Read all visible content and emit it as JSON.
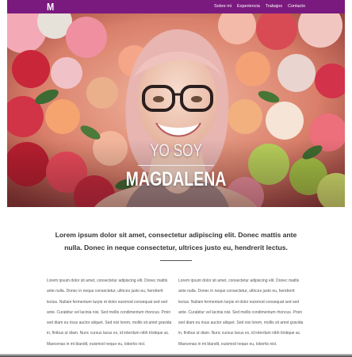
{
  "nav": {
    "logo": "M",
    "links": [
      "Sobre mi",
      "Experiencia",
      "Trabajos",
      "Contacto"
    ]
  },
  "hero": {
    "line1": "YO SOY",
    "line2": "MAGDALENA"
  },
  "intro": {
    "text": "Lorem ipsum dolor sit amet, consectetur adipiscing elit. Donec mattis ante nulla. Donec in neque consectetur, ultrices justo eu, hendrerit lectus."
  },
  "columns": [
    "Lorem ipsum dolor sit amet, consectetur adipiscing elit. Donec mattis ante nulla. Donec in neque consectetur, ultrices justo eu, hendrerit lectus. Nullam fermentum turpis et dolor euismod consequat sed sed ante. Curabitur vel lacinia nisi. Sed mollis condimentum rhoncus. Proin sed diam eu risus auctor aliquet. Sed nisi lorem, mollis sit amet gravida in, finibus ut diam. Nunc cursus lacus ex, id interdum nibh tristique ac. Maecenas in mi blandit, euismod neque eu, lobortis nisl.",
    "Lorem ipsum dolor sit amet, consectetur adipiscing elit. Donec mattis ante nulla. Donec in neque consectetur, ultrices justo eu, hendrerit lectus. Nullam fermentum turpis et dolor euismod consequat sed sed ante. Curabitur vel lacinia nisi. Sed mollis condimentum rhoncus. Proin sed diam eu risus auctor aliquet. Sed nisi lorem, mollis sit amet gravida in, finibus ut diam. Nunc cursus lacus ex, id interdum nibh tristique ac. Maecenas in mi blandit, euismod neque eu, lobortis nisl."
  ],
  "colors": {
    "nav_bg": "#7b1a7e",
    "text_dark": "#333333",
    "text_body": "#555555"
  }
}
